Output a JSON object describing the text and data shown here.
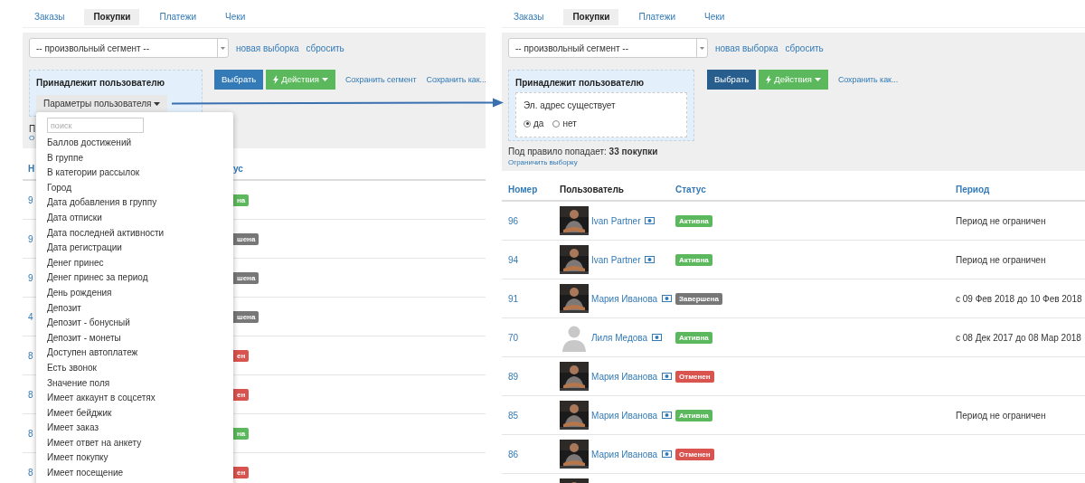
{
  "panels": [
    {
      "tabs": [
        {
          "label": "Заказы",
          "selected": false
        },
        {
          "label": "Покупки",
          "selected": true
        },
        {
          "label": "Платежи",
          "selected": false
        },
        {
          "label": "Чеки",
          "selected": false
        }
      ],
      "segment_select": {
        "value": "-- произвольный сегмент --"
      },
      "links": [
        "новая выборка",
        "сбросить"
      ],
      "condition": {
        "title": "Принадлежит пользователю",
        "parameters_button": "Параметры пользователя"
      },
      "buttons": [
        {
          "label": "Выбрать",
          "kind": "primary",
          "active": false
        },
        {
          "label": "Действия",
          "kind": "actions"
        }
      ],
      "save_links": [
        "Сохранить сегмент",
        "Сохранить как..."
      ],
      "summary": "П",
      "limit_link": "О",
      "table": {
        "columns": [
          {
            "label": "Н",
            "sortable": true
          },
          {
            "label": "ус",
            "sortable": true
          }
        ],
        "rows": [
          {
            "number": "9",
            "status": {
              "label": "на",
              "kind": "active"
            }
          },
          {
            "number": "9",
            "status": {
              "label": "шена",
              "kind": "finished"
            }
          },
          {
            "number": "9",
            "status": {
              "label": "шена",
              "kind": "finished"
            }
          },
          {
            "number": "4",
            "status": {
              "label": "шена",
              "kind": "finished"
            }
          },
          {
            "number": "8",
            "status": {
              "label": "ен",
              "kind": "cancelled"
            }
          },
          {
            "number": "8",
            "status": {
              "label": "ен",
              "kind": "cancelled"
            }
          },
          {
            "number": "8",
            "status": {
              "label": "на",
              "kind": "active"
            }
          },
          {
            "number": "8",
            "status": {
              "label": "ен",
              "kind": "cancelled"
            }
          }
        ]
      },
      "dropdown": {
        "search": {
          "placeholder": "поиск"
        },
        "items": [
          "Баллов достижений",
          "В группе",
          "В категории рассылок",
          "Город",
          "Дата добавления в группу",
          "Дата отписки",
          "Дата последней активности",
          "Дата регистрации",
          "Денег принес",
          "Денег принес за период",
          "День рождения",
          "Депозит",
          "Депозит - бонусный",
          "Депозит - монеты",
          "Доступен автоплатеж",
          "Есть звонок",
          "Значение поля",
          "Имеет аккаунт в соцсетях",
          "Имеет бейджик",
          "Имеет заказ",
          "Имеет ответ на анкету",
          "Имеет покупку",
          "Имеет посещение"
        ]
      }
    },
    {
      "tabs": [
        {
          "label": "Заказы",
          "selected": false
        },
        {
          "label": "Покупки",
          "selected": true
        },
        {
          "label": "Платежи",
          "selected": false
        },
        {
          "label": "Чеки",
          "selected": false
        }
      ],
      "segment_select": {
        "value": "-- произвольный сегмент --"
      },
      "links": [
        "новая выборка",
        "сбросить"
      ],
      "condition": {
        "title": "Принадлежит пользователю",
        "rule": {
          "label": "Эл. адрес существует",
          "options": [
            {
              "label": "да",
              "selected": true
            },
            {
              "label": "нет",
              "selected": false
            }
          ]
        }
      },
      "buttons": [
        {
          "label": "Выбрать",
          "kind": "primary",
          "active": true
        },
        {
          "label": "Действия",
          "kind": "actions"
        }
      ],
      "save_links": [
        "Сохранить как..."
      ],
      "summary": "Под правило попадает: **33 покупки**",
      "limit_link": "Ограничить выборку",
      "table": {
        "columns": [
          {
            "label": "Номер",
            "sortable": true
          },
          {
            "label": "Пользователь",
            "sortable": false
          },
          {
            "label": "Статус",
            "sortable": true
          },
          {
            "label": "Период",
            "sortable": true
          }
        ],
        "rows": [
          {
            "number": "96",
            "user": "Ivan Partner",
            "avatar": {
              "kind": "picture"
            },
            "status": {
              "label": "Активна",
              "kind": "active"
            },
            "period": "Период не ограничен"
          },
          {
            "number": "94",
            "user": "Ivan Partner",
            "avatar": {
              "kind": "picture"
            },
            "status": {
              "label": "Активна",
              "kind": "active"
            },
            "period": "Период не ограничен"
          },
          {
            "number": "91",
            "user": "Мария Иванова",
            "avatar": {
              "kind": "picture"
            },
            "status": {
              "label": "Завершена",
              "kind": "finished"
            },
            "period": "с 09 Фев 2018 до 10 Фев 2018"
          },
          {
            "number": "70",
            "user": "Лиля Медова",
            "avatar": {
              "kind": "silhouette"
            },
            "status": {
              "label": "Активна",
              "kind": "active"
            },
            "period": "с 08 Дек 2017 до 08 Мар 2018"
          },
          {
            "number": "89",
            "user": "Мария Иванова",
            "avatar": {
              "kind": "picture"
            },
            "status": {
              "label": "Отменен",
              "kind": "cancelled"
            }
          },
          {
            "number": "85",
            "user": "Мария Иванова",
            "avatar": {
              "kind": "picture"
            },
            "status": {
              "label": "Активна",
              "kind": "active"
            },
            "period": "Период не ограничен"
          },
          {
            "number": "86",
            "user": "Мария Иванова",
            "avatar": {
              "kind": "picture"
            },
            "status": {
              "label": "Отменен",
              "kind": "cancelled"
            }
          },
          {
            "avatar": {
              "kind": "picture"
            }
          }
        ]
      }
    }
  ]
}
